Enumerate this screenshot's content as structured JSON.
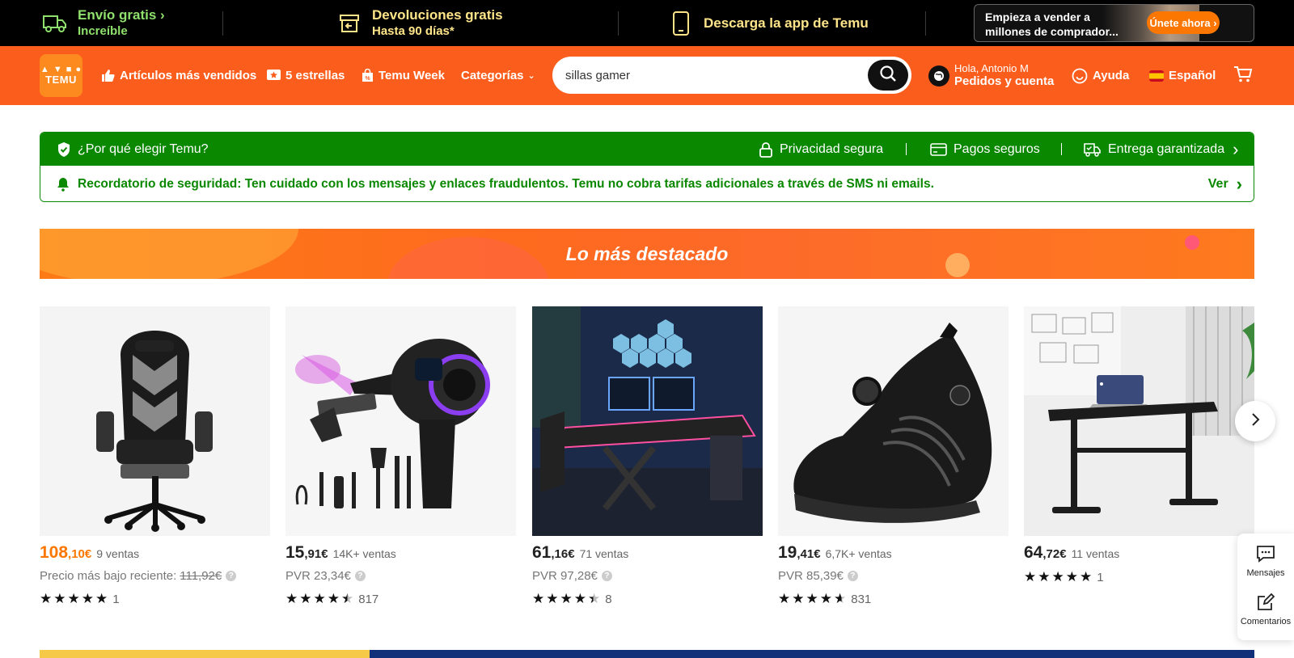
{
  "topbar": {
    "shipping": {
      "title": "Envío gratis",
      "subtitle": "Increíble"
    },
    "returns": {
      "title": "Devoluciones gratis",
      "subtitle": "Hasta 90 días*"
    },
    "app": {
      "title": "Descarga la app de Temu"
    },
    "seller": {
      "text": "Empieza a vender a millones de comprador...",
      "button": "Únete ahora"
    }
  },
  "header": {
    "logo_top": "▲ ▼ ■ ●",
    "logo_text": "TEMU",
    "nav": [
      "Artículos más vendidos",
      "5 estrellas",
      "Temu Week",
      "Categorías"
    ],
    "search_value": "sillas gamer",
    "account_greeting": "Hola, Antonio M",
    "account_label": "Pedidos y cuenta",
    "help": "Ayuda",
    "language": "Español"
  },
  "trust": {
    "why": "¿Por qué elegir Temu?",
    "items": [
      "Privacidad segura",
      "Pagos seguros",
      "Entrega garantizada"
    ],
    "reminder": "Recordatorio de seguridad: Ten cuidado con los mensajes y enlaces fraudulentos. Temu no cobra tarifas adicionales a través de SMS ni emails.",
    "view": "Ver"
  },
  "banner": {
    "title": "Lo más destacado"
  },
  "products": [
    {
      "price_int": "108",
      "price_dec": ",10€",
      "sales": "9 ventas",
      "sub_label": "Precio más bajo reciente:",
      "sub_value": "111,92€",
      "rating": 5,
      "reviews": "1"
    },
    {
      "price_int": "15",
      "price_dec": ",91€",
      "sales": "14K+ ventas",
      "sub_label": "PVR",
      "sub_value": "23,34€",
      "rating": 4.5,
      "reviews": "817"
    },
    {
      "price_int": "61",
      "price_dec": ",16€",
      "sales": "71 ventas",
      "sub_label": "PVR",
      "sub_value": "97,28€",
      "rating": 4.5,
      "reviews": "8"
    },
    {
      "price_int": "19",
      "price_dec": ",41€",
      "sales": "6,7K+ ventas",
      "sub_label": "PVR",
      "sub_value": "85,39€",
      "rating": 4.5,
      "reviews": "831"
    },
    {
      "price_int": "64",
      "price_dec": ",72€",
      "sales": "11 ventas",
      "rating": 5,
      "reviews": "1"
    }
  ],
  "side_panel": {
    "messages": "Mensajes",
    "comments": "Comentarios"
  },
  "colors": {
    "brand_orange": "#fb5d1c",
    "accent_orange": "#fb7701",
    "trust_green": "#0a8800"
  }
}
